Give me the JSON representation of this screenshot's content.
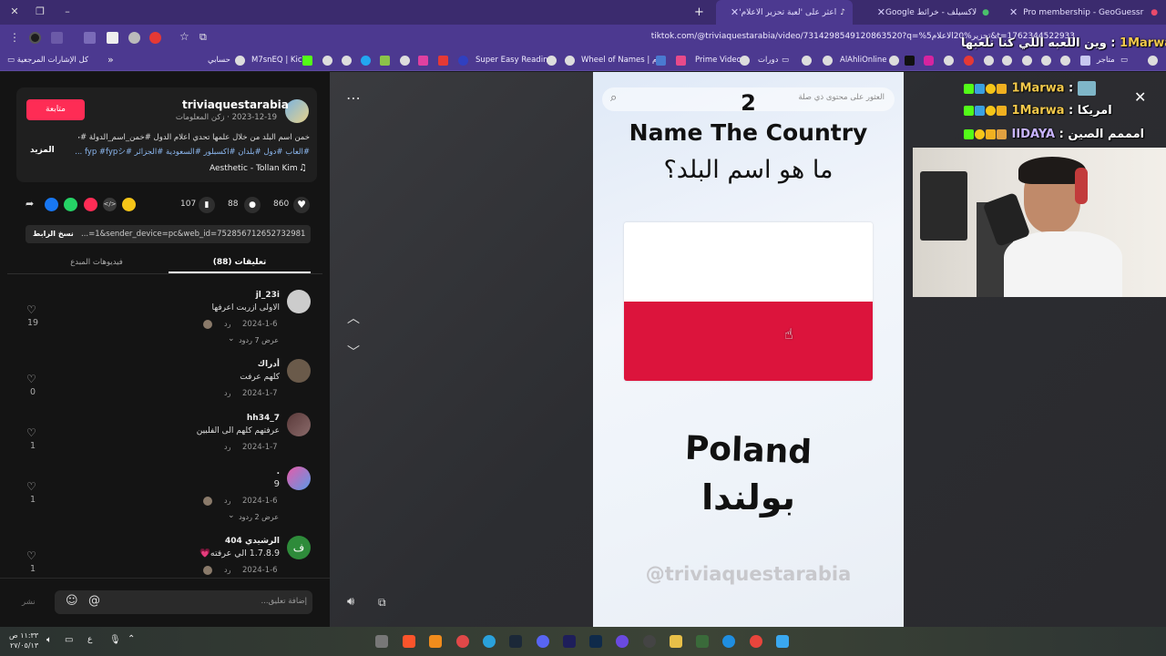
{
  "browser": {
    "tabs": [
      {
        "label": "Pro membership - GeoGuessr"
      },
      {
        "label": "لاكسيلف - خرائط Google"
      },
      {
        "label": "اعثر على 'لعبة تحزير الاعلام'"
      }
    ],
    "url": "tiktok.com/@triviaquestarabia/video/7314298549120863520?q=%5تحزير%20الاعلام&t=1762344522933",
    "bookmarks": [
      "كل الإشارات المرجعية",
      "حسابي",
      "M7snEQ | Kick",
      "Super Easy Reading",
      "Wheel of Names | م...",
      "Prime Video",
      "دورات",
      "AlAhliOnline",
      "متاجر"
    ]
  },
  "post": {
    "username": "triviaquestarabia",
    "subline": "2023-12-19 · زكن المعلومات",
    "follow_label": "متابعة",
    "description_line1": "خمن اسم البلد من خلال علمها تحدي أعلام الدول #خمن_اسم_الدولة #خمن #ذكاء",
    "description_line2": "#العاب #دول #بلدان #اكسبلور #السعودية #الجزائر #fyp #fypシ ...",
    "more_label": "المزيد",
    "music": "Aesthetic - Tollan Kim",
    "likes": "860",
    "comments": "88",
    "saves": "107",
    "link_text": "...=1&sender_device=pc&web_id=7528567126527329810",
    "copy_link_label": "نسخ الرابط",
    "tab_comments": "تعليقات (88)",
    "tab_creator_videos": "فيديوهات المبدع"
  },
  "comments": [
    {
      "user": "jl_23i",
      "text": "الاولى ازربت اعرفها",
      "date": "2024-1-6",
      "reply": "رد",
      "likes": "19",
      "view_replies": "عرض 7 ردود"
    },
    {
      "user": "أدراك",
      "text": "كلهم عرفت",
      "date": "2024-1-7",
      "reply": "رد",
      "likes": "0",
      "view_replies": ""
    },
    {
      "user": "hh34_7",
      "text": "عرفتهم كلهم الى الفلبين",
      "date": "2024-1-7",
      "reply": "رد",
      "likes": "1",
      "view_replies": ""
    },
    {
      "user": ".",
      "text": "9",
      "date": "2024-1-6",
      "reply": "رد",
      "likes": "1",
      "view_replies": "عرض 2 ردود"
    },
    {
      "user": "404 الرشيدي",
      "text": "1.7.8.9 الي عرفته💗",
      "date": "2024-1-6",
      "reply": "رد",
      "likes": "1",
      "view_replies": ""
    }
  ],
  "comment_input": {
    "placeholder": "إضافة تعليق...",
    "post_label": "نشر"
  },
  "video": {
    "search_placeholder": "العثور على محتوى ذي صلة",
    "number": "2",
    "title_en": "Name The Country",
    "title_ar": "ما هو اسم البلد؟",
    "answer_en": "Poland",
    "answer_ar": "بولندا",
    "watermark": "@triviaquestarabia",
    "flag_colors": [
      "#ffffff",
      "#dc143c"
    ]
  },
  "chat": [
    {
      "user": "1Marwa",
      "message": "وين اللعبه اللي كنا نلعبها"
    },
    {
      "user": "1Marwa",
      "message": ""
    },
    {
      "user": "1Marwa",
      "message": "امريكا"
    },
    {
      "user": "IIDAYA",
      "message": "امممم الصين"
    }
  ],
  "taskbar": {
    "time": "١١:٣٣ ص",
    "date": "٢٧/٠٥/١٣"
  }
}
